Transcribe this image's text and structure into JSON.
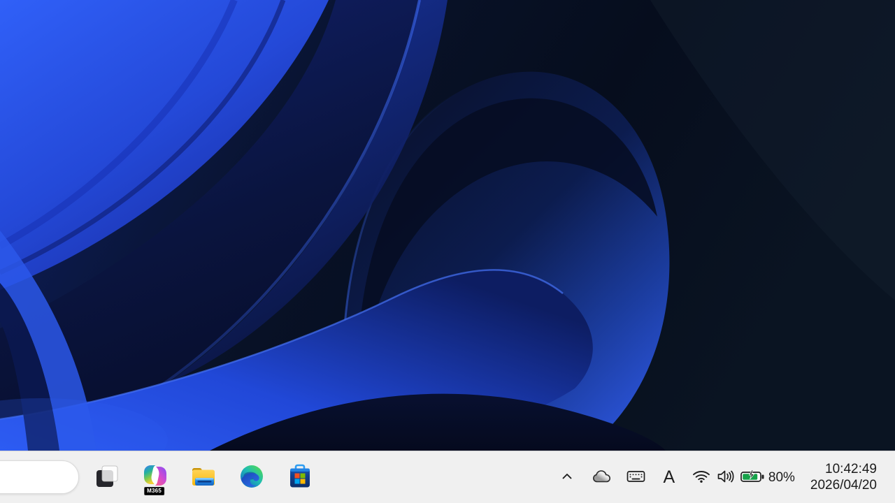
{
  "desktop": {
    "wallpaper": "windows-11-bloom-dark-blue"
  },
  "taskbar": {
    "apps": [
      {
        "id": "task-view"
      },
      {
        "id": "m365-copilot",
        "badge": "M365"
      },
      {
        "id": "file-explorer"
      },
      {
        "id": "microsoft-edge"
      },
      {
        "id": "microsoft-store"
      }
    ],
    "tray": {
      "ime_mode": "A",
      "battery_percent": "80%"
    },
    "clock": {
      "time": "10:42:49",
      "date": "2026/04/20"
    }
  },
  "colors": {
    "taskbar_bg": "#f0f0f0",
    "tray_icon": "#1e1e1e",
    "battery_green": "#17a34a",
    "accent_blue": "#2a52e8",
    "wallpaper_dark": "#070f1f"
  }
}
